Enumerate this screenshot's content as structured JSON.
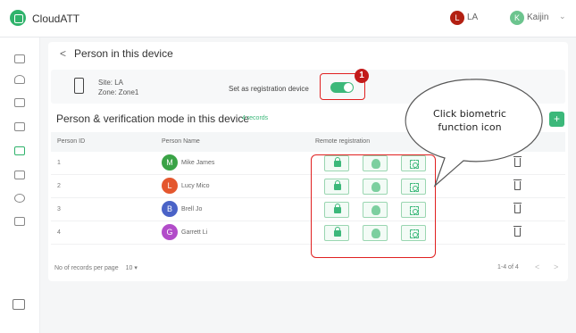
{
  "header": {
    "brand": "CloudATT",
    "user_a_initial": "L",
    "user_a_name": "LA",
    "user_b_initial": "K",
    "user_b_name": "Kaijin"
  },
  "page": {
    "back_arrow": "<",
    "title": "Person in this device"
  },
  "device": {
    "site": "Site: LA",
    "zone": "Zone: Zone1",
    "registration_label": "Set as registration device"
  },
  "step_badge": "1",
  "section": {
    "title": "Person & verification mode in this device",
    "records": "4 records",
    "add_label": "+"
  },
  "table": {
    "columns": [
      "Person ID",
      "Person Name",
      "Remote registration"
    ],
    "rows": [
      {
        "id": "1",
        "initial": "M",
        "name": "Mike James",
        "color": "#3aa346"
      },
      {
        "id": "2",
        "initial": "L",
        "name": "Lucy Mico",
        "color": "#e4572e"
      },
      {
        "id": "3",
        "initial": "B",
        "name": "Brell Jo",
        "color": "#4a63c7"
      },
      {
        "id": "4",
        "initial": "G",
        "name": "Garrett Li",
        "color": "#b24cc9"
      }
    ]
  },
  "pager": {
    "per_page_label": "No of records per page",
    "per_page_value": "10",
    "range": "1-4 of 4",
    "prev": "<",
    "next": ">"
  },
  "callout": {
    "line1": "Click biometric",
    "line2": "function icon"
  },
  "colors": {
    "accent": "#3cb87a",
    "highlight": "#e02020"
  }
}
